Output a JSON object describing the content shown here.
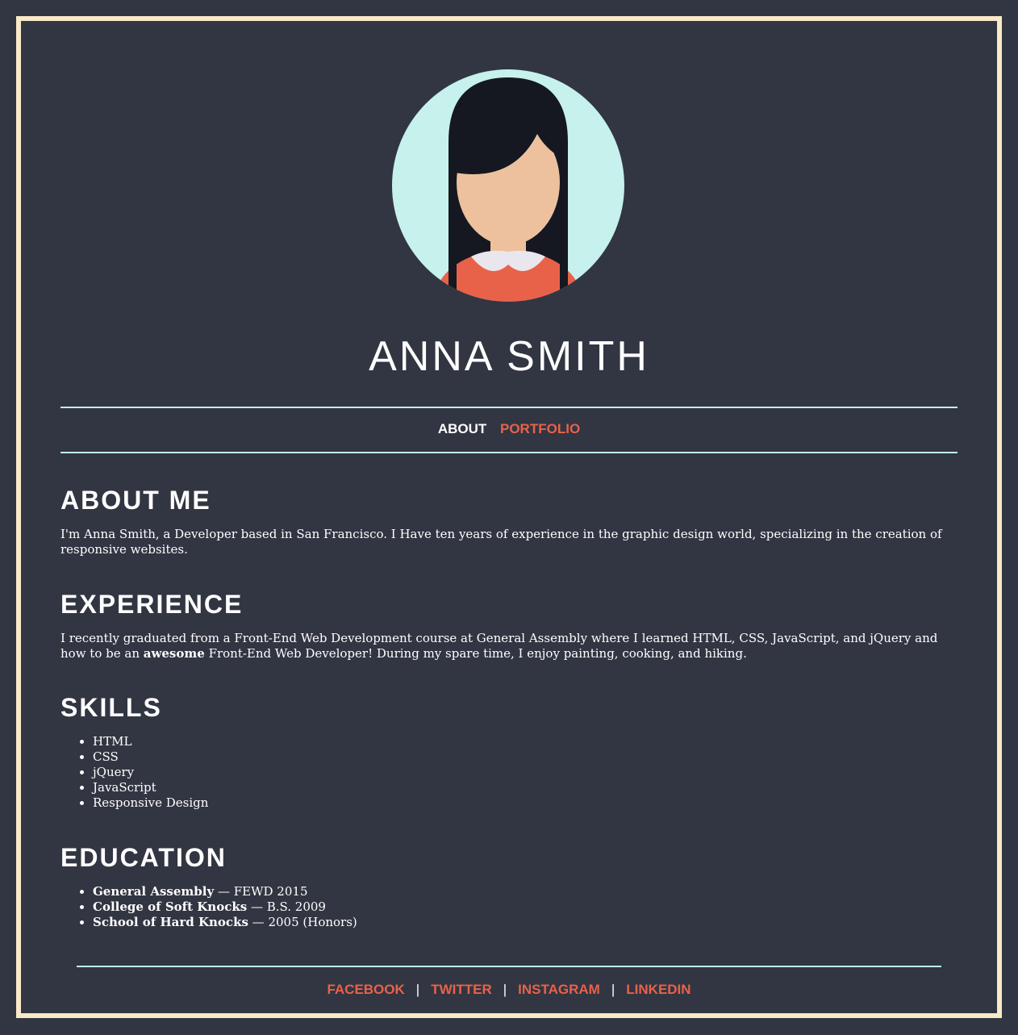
{
  "header": {
    "name": "ANNA SMITH"
  },
  "nav": {
    "about": "ABOUT",
    "portfolio": "PORTFOLIO"
  },
  "about": {
    "heading": "ABOUT ME",
    "text": "I'm Anna Smith, a Developer based in San Francisco. I Have ten years of experience in the graphic design world, specializing in the creation of responsive websites."
  },
  "experience": {
    "heading": "EXPERIENCE",
    "text_before": "I recently graduated from a Front-End Web Development course at General Assembly where I learned HTML, CSS, JavaScript, and jQuery and how to be an ",
    "emphasis": "awesome",
    "text_after": " Front-End Web Developer! During my spare time, I enjoy painting, cooking, and hiking."
  },
  "skills": {
    "heading": "SKILLS",
    "items": [
      "HTML",
      "CSS",
      "jQuery",
      "JavaScript",
      "Responsive Design"
    ]
  },
  "education": {
    "heading": "EDUCATION",
    "items": [
      {
        "school": "General Assembly",
        "detail": " — FEWD 2015"
      },
      {
        "school": "College of Soft Knocks",
        "detail": " — B.S. 2009"
      },
      {
        "school": "School of Hard Knocks",
        "detail": " — 2005 (Honors)"
      }
    ]
  },
  "footer": {
    "links": [
      "FACEBOOK",
      "TWITTER",
      "INSTAGRAM",
      "LINKEDIN"
    ],
    "separator": "|"
  },
  "colors": {
    "background": "#323542",
    "frame": "#f8e9c8",
    "rule": "#bff0ea",
    "accent": "#e8624a",
    "text": "#ffffff"
  },
  "icons": {
    "avatar": "avatar-icon"
  }
}
